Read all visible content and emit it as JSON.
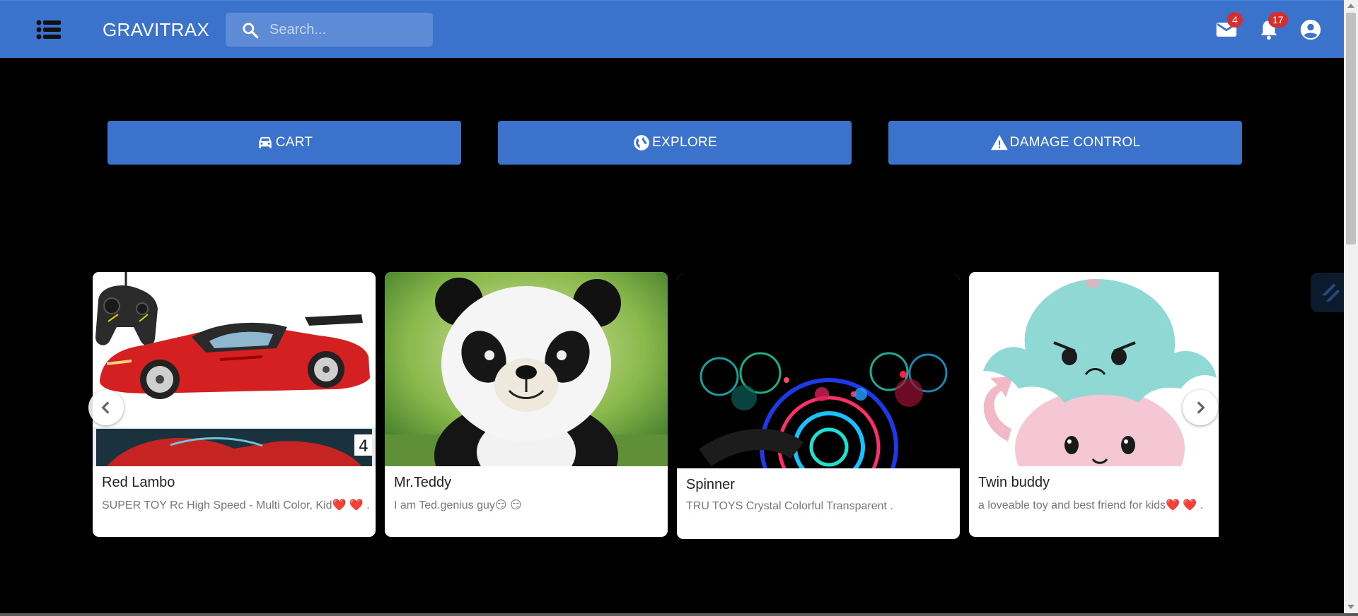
{
  "header": {
    "brand": "GRAVITRAX",
    "search_placeholder": "Search...",
    "mail_count": "4",
    "notification_count": "17",
    "colors": {
      "appbar": "#3b72cc",
      "badge": "#d32f2f"
    },
    "icons": [
      "list-icon",
      "search-icon",
      "mail-icon",
      "bell-icon",
      "account-icon"
    ]
  },
  "actions": [
    {
      "label": "CART",
      "icon": "car-icon"
    },
    {
      "label": "EXPLORE",
      "icon": "globe-icon"
    },
    {
      "label": "DAMAGE CONTROL",
      "icon": "warning-icon"
    }
  ],
  "products": [
    {
      "title": "Red Lambo",
      "description": "SUPER TOY Rc High Speed - Multi Color, Kid❤️ ❤️ ."
    },
    {
      "title": "Mr.Teddy",
      "description": "I am Ted.genius guy😏 😏"
    },
    {
      "title": "Spinner",
      "description": "TRU TOYS Crystal Colorful Transparent ."
    },
    {
      "title": "Twin buddy",
      "description": "a loveable toy and best friend for kids❤️ ❤️ ."
    }
  ],
  "carousel": {
    "prev_icon": "chevron-left-icon",
    "next_icon": "chevron-right-icon"
  }
}
